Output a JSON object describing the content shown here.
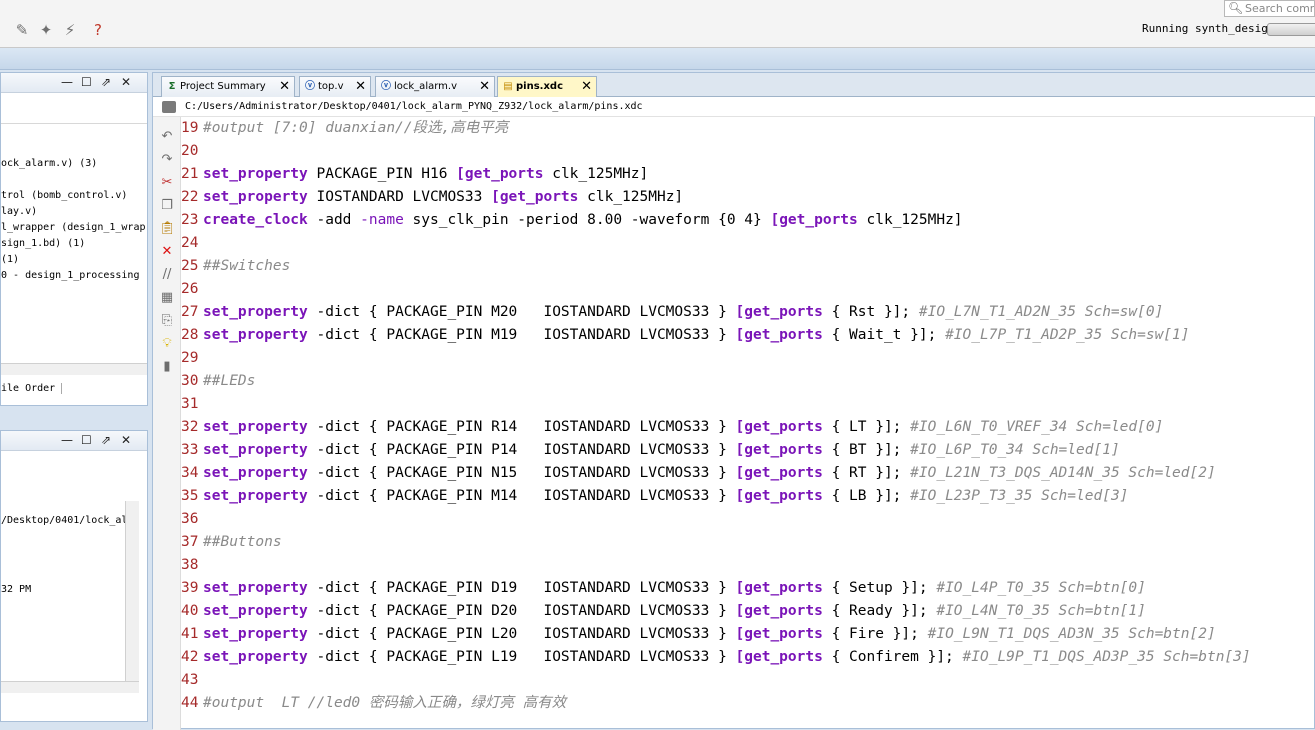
{
  "toolbar": {
    "search_placeholder": "Search comm",
    "status": "Running synth_design"
  },
  "left_top_panel": {
    "tree": [
      "ock_alarm.v) (3)",
      "trol (bomb_control.v)",
      "lay.v)",
      "l_wrapper (design_1_wrap",
      "sign_1.bd) (1)",
      "(1)",
      "0 - design_1_processing"
    ],
    "tab_label": "ile Order"
  },
  "left_bottom_panel": {
    "lines": [
      "/Desktop/0401/lock_al",
      "32 PM"
    ]
  },
  "editor": {
    "tabs": [
      {
        "label": "Project Summary",
        "icon": "sigma-icon"
      },
      {
        "label": "top.v",
        "icon": "verilog-file-icon"
      },
      {
        "label": "lock_alarm.v",
        "icon": "verilog-file-icon"
      },
      {
        "label": "pins.xdc",
        "icon": "xdc-file-icon"
      }
    ],
    "path": "C:/Users/Administrator/Desktop/0401/lock_alarm_PYNQ_Z932/lock_alarm/pins.xdc",
    "lines": [
      {
        "n": "19",
        "segs": [
          {
            "t": "#output [7:0] duanxian//段选,高电平亮",
            "c": "cm"
          }
        ]
      },
      {
        "n": "20",
        "segs": []
      },
      {
        "n": "21",
        "segs": [
          {
            "t": "set_property",
            "c": "kw"
          },
          {
            "t": " PACKAGE_PIN H16 ",
            "c": "pl"
          },
          {
            "t": "[get_ports",
            "c": "kw"
          },
          {
            "t": " clk_125MHz]",
            "c": "pl"
          }
        ]
      },
      {
        "n": "22",
        "segs": [
          {
            "t": "set_property",
            "c": "kw"
          },
          {
            "t": " IOSTANDARD LVCMOS33 ",
            "c": "pl"
          },
          {
            "t": "[get_ports",
            "c": "kw"
          },
          {
            "t": " clk_125MHz]",
            "c": "pl"
          }
        ]
      },
      {
        "n": "23",
        "segs": [
          {
            "t": "create_clock",
            "c": "kw"
          },
          {
            "t": " -add ",
            "c": "pl"
          },
          {
            "t": "-name",
            "c": "sw"
          },
          {
            "t": " sys_clk_pin -period 8.00 -waveform {0 4} ",
            "c": "pl"
          },
          {
            "t": "[get_ports",
            "c": "kw"
          },
          {
            "t": " clk_125MHz]",
            "c": "pl"
          }
        ]
      },
      {
        "n": "24",
        "segs": []
      },
      {
        "n": "25",
        "segs": [
          {
            "t": "##Switches",
            "c": "cm"
          }
        ]
      },
      {
        "n": "26",
        "segs": []
      },
      {
        "n": "27",
        "segs": [
          {
            "t": "set_property",
            "c": "kw"
          },
          {
            "t": " -dict { PACKAGE_PIN M20   IOSTANDARD LVCMOS33 } ",
            "c": "pl"
          },
          {
            "t": "[get_ports",
            "c": "kw"
          },
          {
            "t": " { Rst }]; ",
            "c": "pl"
          },
          {
            "t": "#IO_L7N_T1_AD2N_35 Sch=sw[0]",
            "c": "cm"
          }
        ]
      },
      {
        "n": "28",
        "segs": [
          {
            "t": "set_property",
            "c": "kw"
          },
          {
            "t": " -dict { PACKAGE_PIN M19   IOSTANDARD LVCMOS33 } ",
            "c": "pl"
          },
          {
            "t": "[get_ports",
            "c": "kw"
          },
          {
            "t": " { Wait_t }]; ",
            "c": "pl"
          },
          {
            "t": "#IO_L7P_T1_AD2P_35 Sch=sw[1]",
            "c": "cm"
          }
        ]
      },
      {
        "n": "29",
        "segs": []
      },
      {
        "n": "30",
        "segs": [
          {
            "t": "##LEDs",
            "c": "cm"
          }
        ]
      },
      {
        "n": "31",
        "segs": []
      },
      {
        "n": "32",
        "segs": [
          {
            "t": "set_property",
            "c": "kw"
          },
          {
            "t": " -dict { PACKAGE_PIN R14   IOSTANDARD LVCMOS33 } ",
            "c": "pl"
          },
          {
            "t": "[get_ports",
            "c": "kw"
          },
          {
            "t": " { LT }]; ",
            "c": "pl"
          },
          {
            "t": "#IO_L6N_T0_VREF_34 Sch=led[0]",
            "c": "cm"
          }
        ]
      },
      {
        "n": "33",
        "segs": [
          {
            "t": "set_property",
            "c": "kw"
          },
          {
            "t": " -dict { PACKAGE_PIN P14   IOSTANDARD LVCMOS33 } ",
            "c": "pl"
          },
          {
            "t": "[get_ports",
            "c": "kw"
          },
          {
            "t": " { BT }]; ",
            "c": "pl"
          },
          {
            "t": "#IO_L6P_T0_34 Sch=led[1]",
            "c": "cm"
          }
        ]
      },
      {
        "n": "34",
        "segs": [
          {
            "t": "set_property",
            "c": "kw"
          },
          {
            "t": " -dict { PACKAGE_PIN N15   IOSTANDARD LVCMOS33 } ",
            "c": "pl"
          },
          {
            "t": "[get_ports",
            "c": "kw"
          },
          {
            "t": " { RT }]; ",
            "c": "pl"
          },
          {
            "t": "#IO_L21N_T3_DQS_AD14N_35 Sch=led[2]",
            "c": "cm"
          }
        ]
      },
      {
        "n": "35",
        "segs": [
          {
            "t": "set_property",
            "c": "kw"
          },
          {
            "t": " -dict { PACKAGE_PIN M14   IOSTANDARD LVCMOS33 } ",
            "c": "pl"
          },
          {
            "t": "[get_ports",
            "c": "kw"
          },
          {
            "t": " { LB }]; ",
            "c": "pl"
          },
          {
            "t": "#IO_L23P_T3_35 Sch=led[3]",
            "c": "cm"
          }
        ]
      },
      {
        "n": "36",
        "segs": []
      },
      {
        "n": "37",
        "segs": [
          {
            "t": "##Buttons",
            "c": "cm"
          }
        ]
      },
      {
        "n": "38",
        "segs": []
      },
      {
        "n": "39",
        "segs": [
          {
            "t": "set_property",
            "c": "kw"
          },
          {
            "t": " -dict { PACKAGE_PIN D19   IOSTANDARD LVCMOS33 } ",
            "c": "pl"
          },
          {
            "t": "[get_ports",
            "c": "kw"
          },
          {
            "t": " { Setup }]; ",
            "c": "pl"
          },
          {
            "t": "#IO_L4P_T0_35 Sch=btn[0]",
            "c": "cm"
          }
        ]
      },
      {
        "n": "40",
        "segs": [
          {
            "t": "set_property",
            "c": "kw"
          },
          {
            "t": " -dict { PACKAGE_PIN D20   IOSTANDARD LVCMOS33 } ",
            "c": "pl"
          },
          {
            "t": "[get_ports",
            "c": "kw"
          },
          {
            "t": " { Ready }]; ",
            "c": "pl"
          },
          {
            "t": "#IO_L4N_T0_35 Sch=btn[1]",
            "c": "cm"
          }
        ]
      },
      {
        "n": "41",
        "segs": [
          {
            "t": "set_property",
            "c": "kw"
          },
          {
            "t": " -dict { PACKAGE_PIN L20   IOSTANDARD LVCMOS33 } ",
            "c": "pl"
          },
          {
            "t": "[get_ports",
            "c": "kw"
          },
          {
            "t": " { Fire }]; ",
            "c": "pl"
          },
          {
            "t": "#IO_L9N_T1_DQS_AD3N_35 Sch=btn[2]",
            "c": "cm"
          }
        ]
      },
      {
        "n": "42",
        "segs": [
          {
            "t": "set_property",
            "c": "kw"
          },
          {
            "t": " -dict { PACKAGE_PIN L19   IOSTANDARD LVCMOS33 } ",
            "c": "pl"
          },
          {
            "t": "[get_ports",
            "c": "kw"
          },
          {
            "t": " { Confirem }]; ",
            "c": "pl"
          },
          {
            "t": "#IO_L9P_T1_DQS_AD3P_35 Sch=btn[3]",
            "c": "cm"
          }
        ]
      },
      {
        "n": "43",
        "segs": []
      },
      {
        "n": "44",
        "segs": [
          {
            "t": "#output  LT //led0 密码输入正确，绿灯亮 高有效",
            "c": "cm"
          }
        ]
      }
    ]
  }
}
